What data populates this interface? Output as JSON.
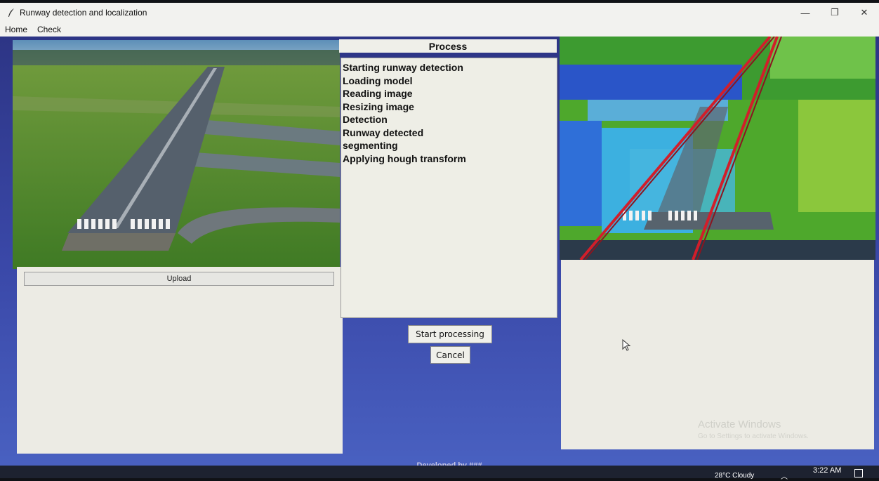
{
  "window": {
    "title": "Runway detection and localization",
    "controls": {
      "minimize": "—",
      "restore": "❐",
      "close": "✕"
    }
  },
  "menu": [
    "Home",
    "Check"
  ],
  "left": {
    "upload_label": "Upload"
  },
  "process": {
    "header": "Process",
    "log": [
      "Starting runway detection",
      "Loading model",
      "Reading image",
      "Resizing image",
      "Detection",
      "Runway detected",
      "segmenting",
      "Applying hough transform"
    ],
    "start_label": "Start processing",
    "cancel_label": "Cancel"
  },
  "right": {
    "watermark_title": "Activate Windows",
    "watermark_sub": "Go to Settings to activate Windows."
  },
  "footer": "Developed by ###",
  "taskbar": {
    "weather": "28°C  Cloudy",
    "time": "3:22 AM"
  },
  "colors": {
    "accent": "#3a48a8",
    "panel": "#ecebe4",
    "hough_line": "#d21e2a"
  }
}
